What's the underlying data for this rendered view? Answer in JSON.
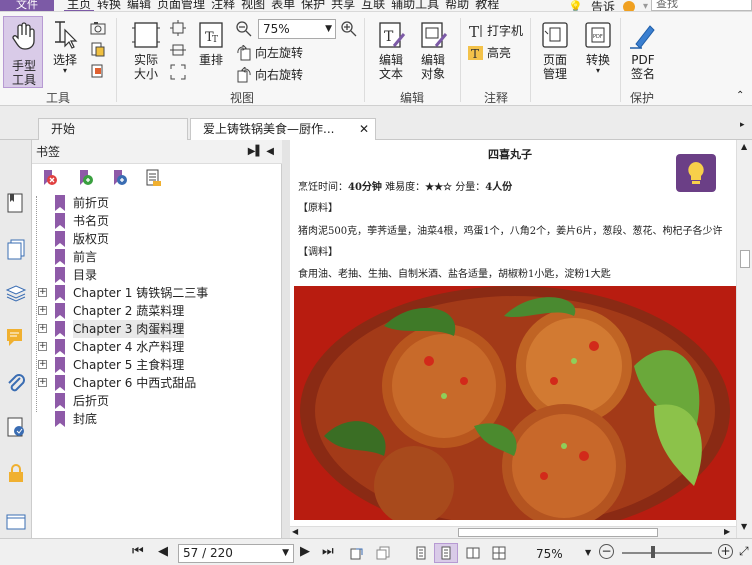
{
  "menubar": {
    "file_label": "文件",
    "menus": [
      "主页",
      "转换",
      "编辑",
      "页面管理",
      "注释",
      "视图",
      "表单",
      "保护",
      "共享",
      "互联",
      "辅助工具",
      "帮助",
      "教程"
    ],
    "active_menu": "主页",
    "tell_me": "告诉",
    "search_placeholder": "查找"
  },
  "ribbon": {
    "hand_tool": "手型\n工具",
    "hand_tool_l1": "手型",
    "hand_tool_l2": "工具",
    "select_l1": "选择",
    "group_tools": "工具",
    "actual_size_l1": "实际",
    "actual_size_l2": "大小",
    "reflow": "重排",
    "zoom_value": "75%",
    "rotate_left": "向左旋转",
    "rotate_right": "向右旋转",
    "group_view": "视图",
    "edit_text_l1": "编辑",
    "edit_text_l2": "文本",
    "edit_object_l1": "编辑",
    "edit_object_l2": "对象",
    "group_edit": "编辑",
    "typewriter": "打字机",
    "highlight": "高亮",
    "group_comment": "注释",
    "page_manage_l1": "页面",
    "page_manage_l2": "管理",
    "convert": "转换",
    "pdf_sign_l1": "PDF",
    "pdf_sign_l2": "签名",
    "group_protect": "保护"
  },
  "tabs": [
    {
      "label": "开始"
    },
    {
      "label": "爱上铸铁锅美食—厨作..."
    }
  ],
  "bookmarks": {
    "title": "书签",
    "items": [
      {
        "label": "前折页",
        "expandable": false
      },
      {
        "label": "书名页",
        "expandable": false
      },
      {
        "label": "版权页",
        "expandable": false
      },
      {
        "label": "前言",
        "expandable": false
      },
      {
        "label": "目录",
        "expandable": false
      },
      {
        "label": "Chapter 1 铸铁锅二三事",
        "expandable": true
      },
      {
        "label": "Chapter 2 蔬菜料理",
        "expandable": true
      },
      {
        "label": "Chapter 3 肉蛋料理",
        "expandable": true,
        "selected": true
      },
      {
        "label": "Chapter 4 水产料理",
        "expandable": true
      },
      {
        "label": "Chapter 5 主食料理",
        "expandable": true
      },
      {
        "label": "Chapter 6 中西式甜品",
        "expandable": true
      },
      {
        "label": "后折页",
        "expandable": false
      },
      {
        "label": "封底",
        "expandable": false
      }
    ]
  },
  "document": {
    "title": "四喜丸子",
    "meta_prefix": "烹饪时间：",
    "cook_time": "40分钟",
    "difficulty_label": " 难易度：",
    "stars": "★★☆",
    "servings_label": " 分量：",
    "servings": "4人份",
    "ingredients_heading": "【原料】",
    "ingredients": "猪肉泥500克，荸荠适量，油菜4根，鸡蛋1个，八角2个，姜片6片，葱段、葱花、枸杞子各少许",
    "seasoning_heading": "【调料】",
    "seasoning": "食用油、老抽、生抽、自制米酒、盐各适量，胡椒粉1小匙，淀粉1大匙"
  },
  "statusbar": {
    "page_value": "57 / 220",
    "zoom": "75%"
  },
  "colors": {
    "accent": "#7c5aa6",
    "bookmark_flag": "#8e5aa8",
    "bulb_bg": "#6b3f86"
  }
}
